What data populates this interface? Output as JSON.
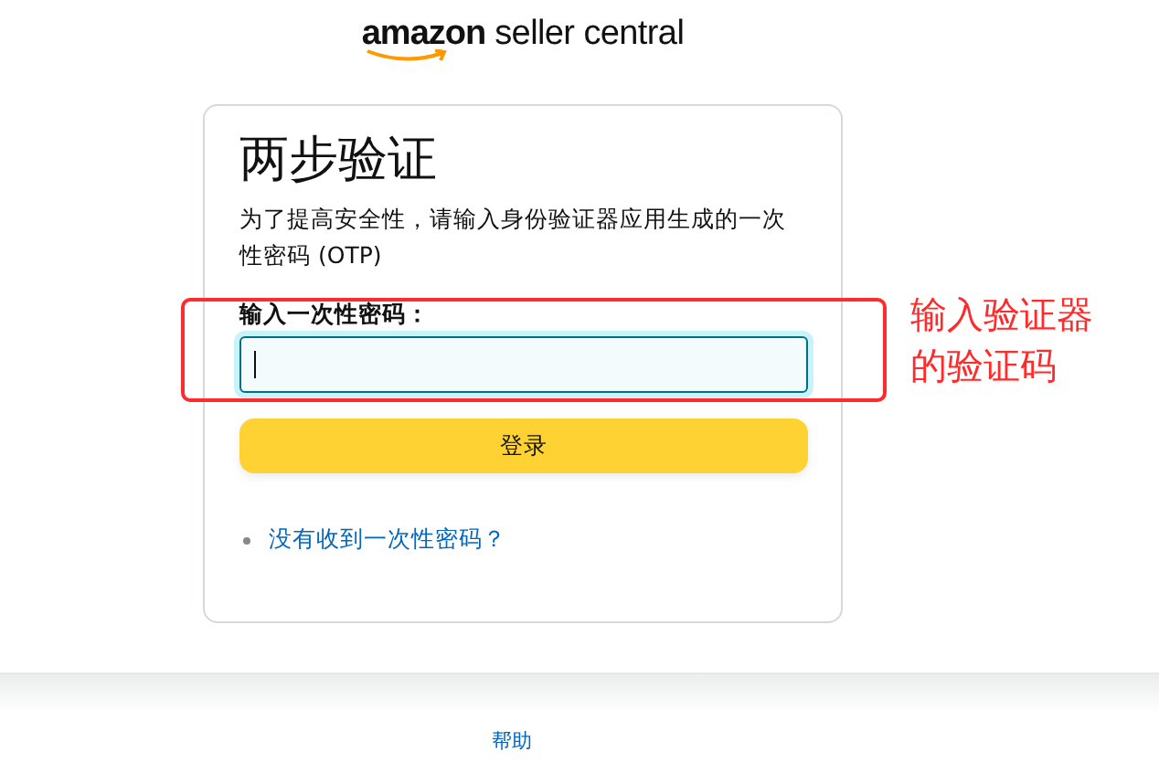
{
  "logo": {
    "brand": "amazon",
    "product": "seller central"
  },
  "card": {
    "title": "两步验证",
    "description": "为了提高安全性，请输入身份验证器应用生成的一次性密码 (OTP)",
    "field_label": "输入一次性密码：",
    "otp_field": {
      "focused": true
    },
    "submit_button": "登录",
    "links": [
      "没有收到一次性密码？"
    ]
  },
  "annotation": {
    "text": "输入验证器的验证码",
    "color": "#ff2a2a"
  },
  "footer": {
    "links": [
      "帮助"
    ]
  }
}
